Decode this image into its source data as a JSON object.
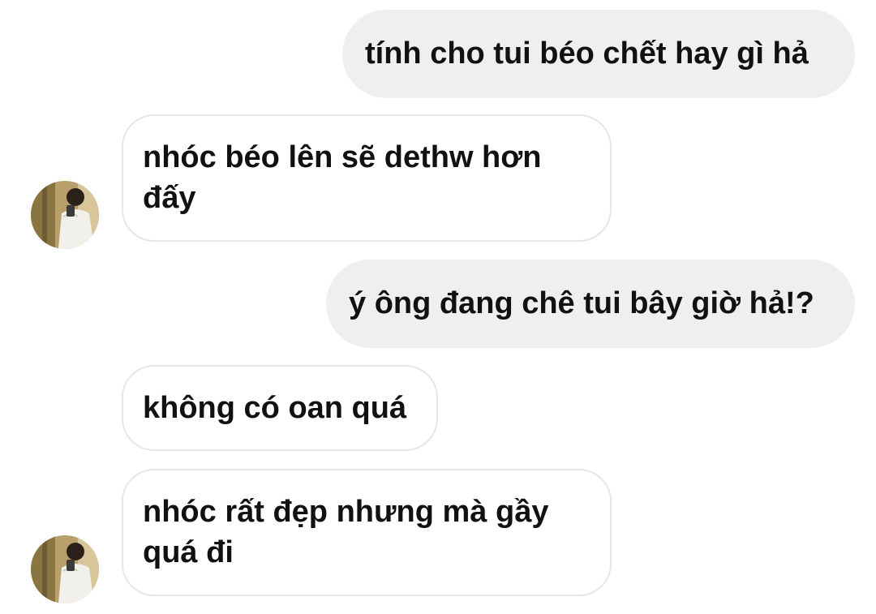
{
  "conversation": {
    "messages": [
      {
        "direction": "outgoing",
        "text": "tính cho tui béo chết hay gì hả"
      },
      {
        "direction": "incoming",
        "lines": [
          "nhóc béo lên sẽ dethw hơn",
          "đấy"
        ]
      },
      {
        "direction": "outgoing",
        "text": "ý ông đang chê tui bây giờ hả!?"
      },
      {
        "direction": "incoming",
        "text": "không có oan quá"
      },
      {
        "direction": "incoming",
        "lines": [
          "nhóc rất đẹp nhưng mà gầy",
          "quá đi"
        ]
      }
    ],
    "contact_avatar_icon": "profile-photo-avatar"
  }
}
